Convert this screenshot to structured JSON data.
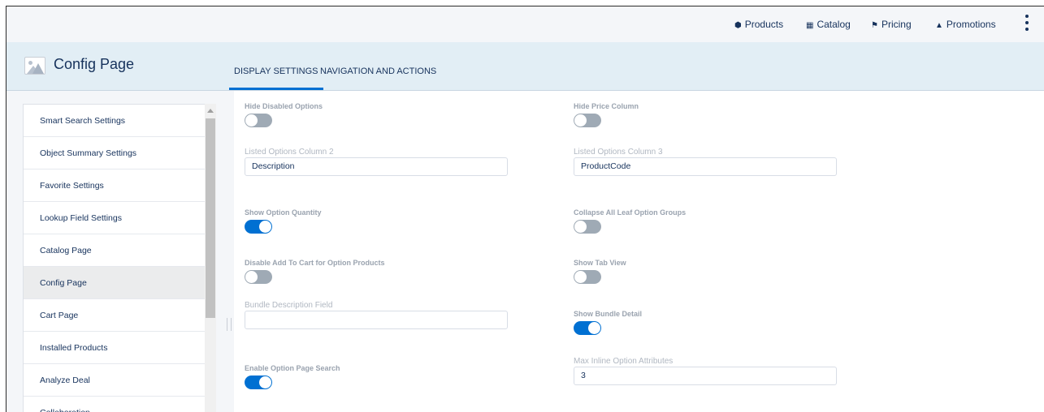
{
  "topnav": {
    "items": [
      {
        "label": "Products",
        "icon": "cube-icon"
      },
      {
        "label": "Catalog",
        "icon": "grid-icon"
      },
      {
        "label": "Pricing",
        "icon": "tag-icon"
      },
      {
        "label": "Promotions",
        "icon": "gift-icon"
      }
    ]
  },
  "header": {
    "title": "Config Page",
    "tabs": [
      {
        "label": "DISPLAY SETTINGS",
        "active": true
      },
      {
        "label": "NAVIGATION AND ACTIONS",
        "active": false
      }
    ]
  },
  "sidebar": {
    "items": [
      {
        "label": "Smart Search Settings"
      },
      {
        "label": "Object Summary Settings"
      },
      {
        "label": "Favorite Settings"
      },
      {
        "label": "Lookup Field Settings"
      },
      {
        "label": "Catalog Page"
      },
      {
        "label": "Config Page",
        "selected": true
      },
      {
        "label": "Cart Page"
      },
      {
        "label": "Installed Products"
      },
      {
        "label": "Analyze Deal"
      },
      {
        "label": "Collaboration"
      }
    ]
  },
  "settings": {
    "hide_disabled_options": {
      "label": "Hide Disabled Options",
      "on": false
    },
    "hide_price_column": {
      "label": "Hide Price Column",
      "on": false
    },
    "listed_options_col2": {
      "label": "Listed Options Column 2",
      "value": "Description"
    },
    "listed_options_col3": {
      "label": "Listed Options Column 3",
      "value": "ProductCode"
    },
    "show_option_quantity": {
      "label": "Show Option Quantity",
      "on": true
    },
    "collapse_leaf_groups": {
      "label": "Collapse All Leaf Option Groups",
      "on": false
    },
    "disable_add_to_cart": {
      "label": "Disable Add To Cart for Option Products",
      "on": false
    },
    "show_tab_view": {
      "label": "Show Tab View",
      "on": false
    },
    "bundle_description_field": {
      "label": "Bundle Description Field",
      "value": ""
    },
    "show_bundle_detail": {
      "label": "Show Bundle Detail",
      "on": true
    },
    "enable_option_page_search": {
      "label": "Enable Option Page Search",
      "on": true
    },
    "max_inline_option_attributes": {
      "label": "Max Inline Option Attributes",
      "value": "3"
    }
  },
  "colors": {
    "accent": "#0070d2",
    "header_bg": "#e2eef5",
    "toggle_off": "#9faab5"
  }
}
